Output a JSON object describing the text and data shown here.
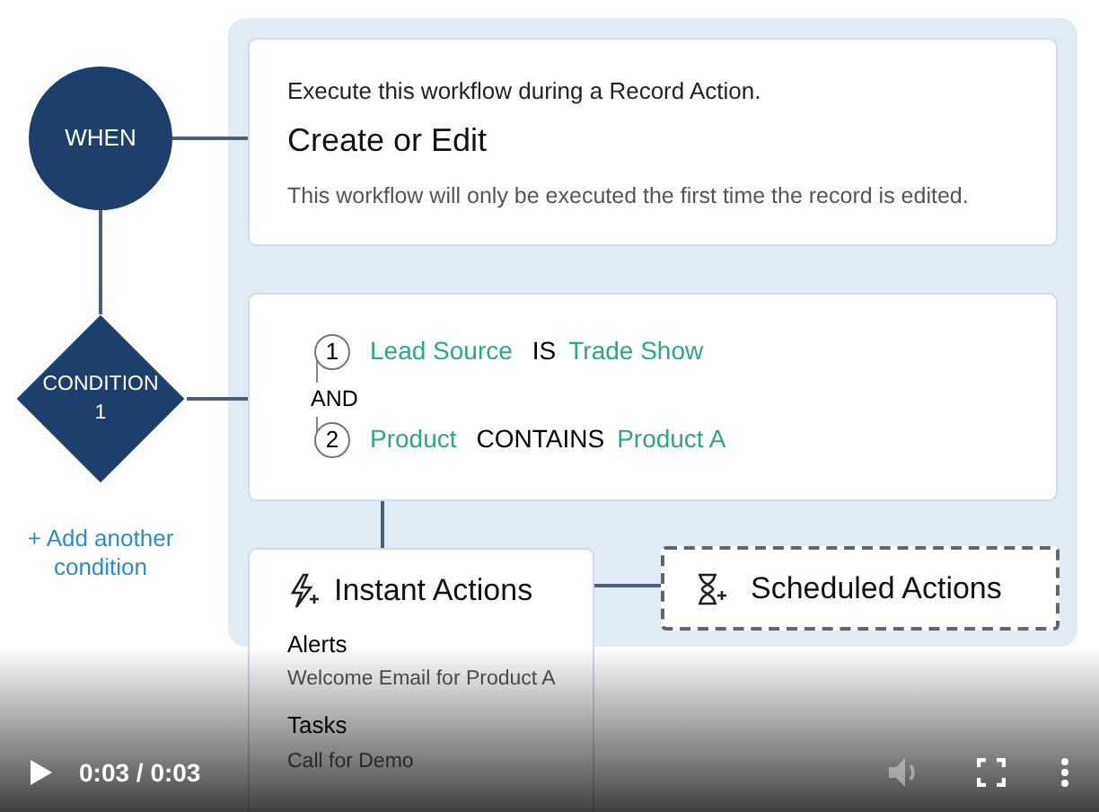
{
  "trigger": {
    "label": "WHEN",
    "intro": "Execute this workflow during a Record Action.",
    "title": "Create or Edit",
    "note": "This workflow will only be executed the first time the record is edited."
  },
  "condition": {
    "label": "CONDITION",
    "number": "1",
    "joiner": "AND",
    "add_link": "+ Add another condition",
    "criteria": [
      {
        "number": "1",
        "field": "Lead Source",
        "operator": "IS",
        "value": "Trade Show"
      },
      {
        "number": "2",
        "field": "Product",
        "operator": "CONTAINS",
        "value": "Product A"
      }
    ]
  },
  "instant_actions": {
    "title": "Instant Actions",
    "groups": [
      {
        "heading": "Alerts",
        "item": "Welcome Email for Product A"
      },
      {
        "heading": "Tasks",
        "item": "Call for Demo"
      }
    ]
  },
  "scheduled_actions": {
    "title": "Scheduled Actions"
  },
  "player": {
    "time": "0:03 / 0:03",
    "volume_disabled": true
  }
}
